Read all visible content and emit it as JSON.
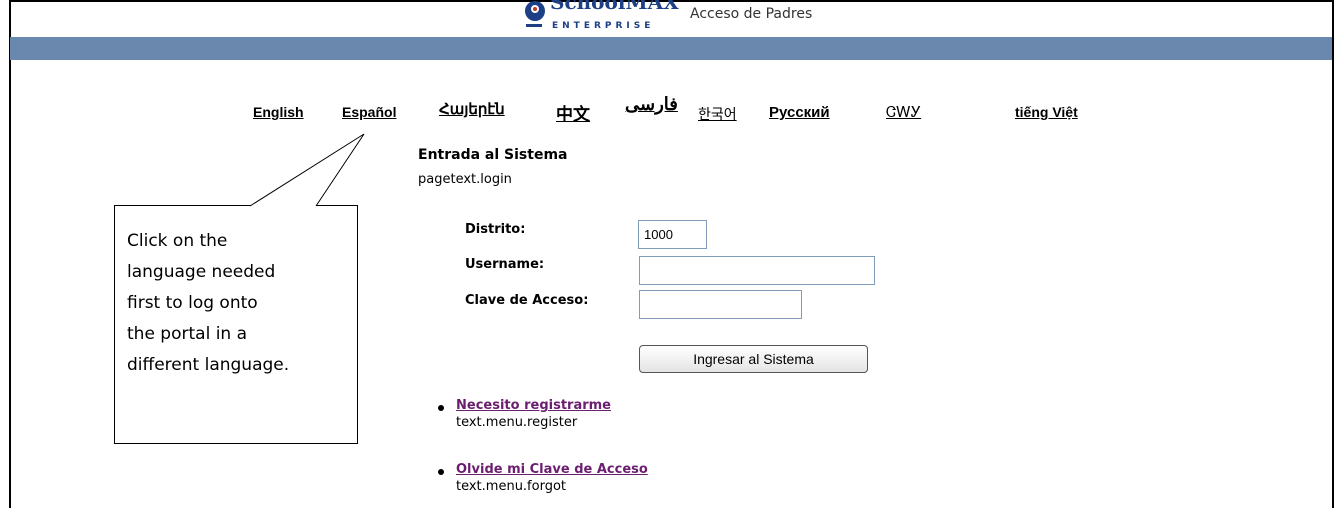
{
  "header": {
    "logo_text": "SchoolMAX",
    "logo_subtext": "ENTERPRISE",
    "title": "Acceso de Padres",
    "bar_color": "#6a88ae"
  },
  "languages": [
    {
      "label": "English"
    },
    {
      "label": "Español"
    },
    {
      "label": "Հայերէն"
    },
    {
      "label": "中文"
    },
    {
      "label": "فارسی"
    },
    {
      "label": "한국어"
    },
    {
      "label": "Русский"
    },
    {
      "label": "ᏣᎳᎩ"
    },
    {
      "label": "tiếng Việt"
    }
  ],
  "login": {
    "title": "Entrada al Sistema",
    "subtitle": "pagetext.login",
    "district_label": "Distrito:",
    "district_value": "1000",
    "username_label": "Username:",
    "username_value": "",
    "password_label": "Clave de Acceso:",
    "password_value": "",
    "submit_label": "Ingresar al Sistema"
  },
  "menu": [
    {
      "link": "Necesito registrarme",
      "sub": "text.menu.register"
    },
    {
      "link": "Olvide mi Clave de Acceso",
      "sub": "text.menu.forgot"
    }
  ],
  "callout": {
    "text": "Click on the\nlanguage needed\nfirst to log onto\nthe portal in a\ndifferent language."
  },
  "colors": {
    "link_visited": "#6b1e6f",
    "input_border": "#7f9db9",
    "brand_blue": "#1c3f86"
  }
}
